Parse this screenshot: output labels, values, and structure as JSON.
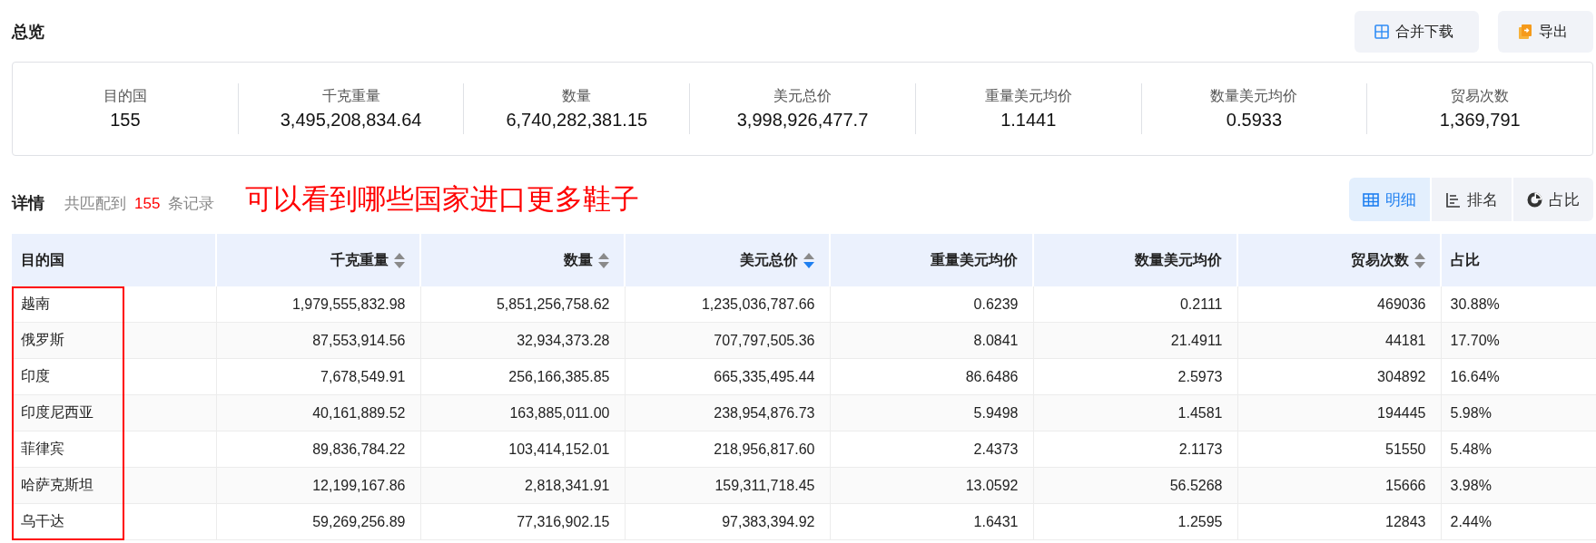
{
  "overview": {
    "title": "总览",
    "buttons": [
      {
        "kind": "merge",
        "label": "合并下载"
      },
      {
        "kind": "export",
        "label": "导出"
      }
    ]
  },
  "summary": [
    {
      "label": "目的国",
      "value": "155"
    },
    {
      "label": "千克重量",
      "value": "3,495,208,834.64"
    },
    {
      "label": "数量",
      "value": "6,740,282,381.15"
    },
    {
      "label": "美元总价",
      "value": "3,998,926,477.7"
    },
    {
      "label": "重量美元均价",
      "value": "1.1441"
    },
    {
      "label": "数量美元均价",
      "value": "0.5933"
    },
    {
      "label": "贸易次数",
      "value": "1,369,791"
    }
  ],
  "details": {
    "title": "详情",
    "match_prefix": "共匹配到",
    "match_count": "155",
    "match_suffix": "条记录",
    "annotation": "可以看到哪些国家进口更多鞋子",
    "views": [
      {
        "kind": "table",
        "label": "明细",
        "selected": true
      },
      {
        "kind": "rank",
        "label": "排名",
        "selected": false
      },
      {
        "kind": "pie",
        "label": "占比",
        "selected": false
      }
    ]
  },
  "table": {
    "columns": [
      {
        "label": "目的国",
        "numeric": false,
        "sortable": false
      },
      {
        "label": "千克重量",
        "numeric": true,
        "sortable": true,
        "sorted": false
      },
      {
        "label": "数量",
        "numeric": true,
        "sortable": true,
        "sorted": false
      },
      {
        "label": "美元总价",
        "numeric": true,
        "sortable": true,
        "sorted": true
      },
      {
        "label": "重量美元均价",
        "numeric": true,
        "sortable": false
      },
      {
        "label": "数量美元均价",
        "numeric": true,
        "sortable": false
      },
      {
        "label": "贸易次数",
        "numeric": true,
        "sortable": true,
        "sorted": false
      },
      {
        "label": "占比",
        "numeric": false,
        "sortable": false
      }
    ],
    "rows": [
      [
        "越南",
        "1,979,555,832.98",
        "5,851,256,758.62",
        "1,235,036,787.66",
        "0.6239",
        "0.2111",
        "469036",
        "30.88%"
      ],
      [
        "俄罗斯",
        "87,553,914.56",
        "32,934,373.28",
        "707,797,505.36",
        "8.0841",
        "21.4911",
        "44181",
        "17.70%"
      ],
      [
        "印度",
        "7,678,549.91",
        "256,166,385.85",
        "665,335,495.44",
        "86.6486",
        "2.5973",
        "304892",
        "16.64%"
      ],
      [
        "印度尼西亚",
        "40,161,889.52",
        "163,885,011.00",
        "238,954,876.73",
        "5.9498",
        "1.4581",
        "194445",
        "5.98%"
      ],
      [
        "菲律宾",
        "89,836,784.22",
        "103,414,152.01",
        "218,956,817.60",
        "2.4373",
        "2.1173",
        "51550",
        "5.48%"
      ],
      [
        "哈萨克斯坦",
        "12,199,167.86",
        "2,818,341.91",
        "159,311,718.45",
        "13.0592",
        "56.5268",
        "15666",
        "3.98%"
      ],
      [
        "乌干达",
        "59,269,256.89",
        "77,316,902.15",
        "97,383,394.92",
        "1.6431",
        "1.2595",
        "12843",
        "2.44%"
      ]
    ]
  }
}
